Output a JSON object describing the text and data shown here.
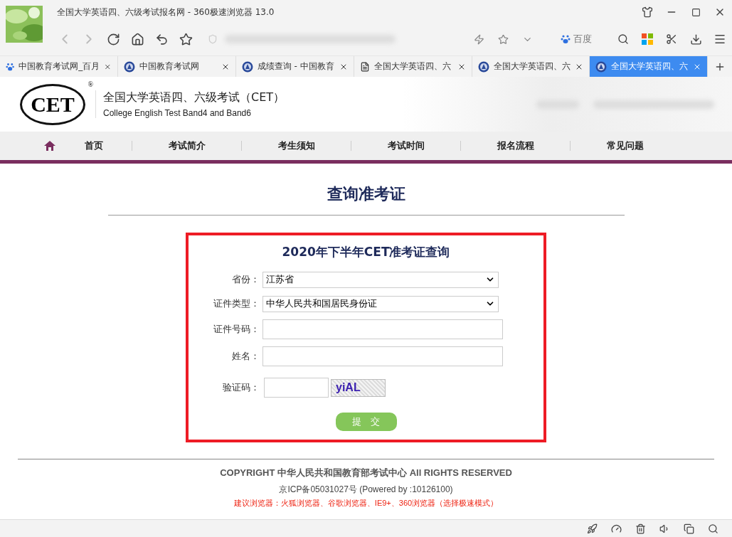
{
  "browser": {
    "title": "全国大学英语四、六级考试报名网 - 360极速浏览器 13.0",
    "search_engine": "百度",
    "tabs": [
      {
        "label": "中国教育考试网_百月",
        "selected": false
      },
      {
        "label": "中国教育考试网",
        "selected": false
      },
      {
        "label": "成绩查询 - 中国教育",
        "selected": false
      },
      {
        "label": "全国大学英语四、六",
        "selected": false
      },
      {
        "label": "全国大学英语四、六",
        "selected": false
      },
      {
        "label": "全国大学英语四、六",
        "selected": true
      }
    ]
  },
  "site": {
    "logo": "CET",
    "reg": "®",
    "title": "全国大学英语四、六级考试（CET）",
    "subtitle": "College English Test Band4 and Band6",
    "nav": [
      "首页",
      "考试简介",
      "考生须知",
      "考试时间",
      "报名流程",
      "常见问题"
    ]
  },
  "page_title": "查询准考证",
  "form": {
    "title": "2020年下半年CET准考证查询",
    "fields": [
      {
        "label": "省份：",
        "kind": "select",
        "value": "江苏省"
      },
      {
        "label": "证件类型：",
        "kind": "select",
        "value": "中华人民共和国居民身份证"
      },
      {
        "label": "证件号码：",
        "kind": "text"
      },
      {
        "label": "姓名：",
        "kind": "text"
      },
      {
        "label": "验证码：",
        "kind": "captcha",
        "captcha": "yiAL"
      }
    ],
    "submit": "提　交"
  },
  "footer": {
    "copyright": "COPYRIGHT 中华人民共和国教育部考试中心 All RIGHTS RESERVED",
    "icp": "京ICP备05031027号 (Powered by :10126100)",
    "browsers": "建议浏览器：火狐浏览器、谷歌浏览器、IE9+、360浏览器（选择极速模式）"
  }
}
